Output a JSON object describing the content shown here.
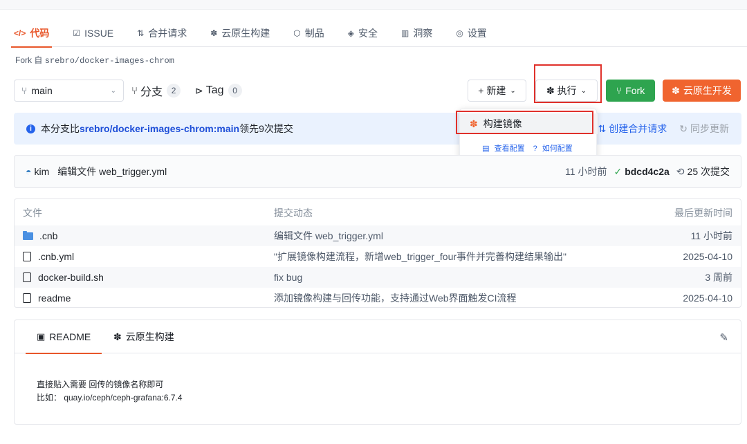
{
  "tabs": [
    {
      "icon": "</>",
      "label": "代码",
      "active": true
    },
    {
      "icon": "☑",
      "label": "ISSUE"
    },
    {
      "icon": "⇅",
      "label": "合并请求"
    },
    {
      "icon": "✽",
      "label": "云原生构建"
    },
    {
      "icon": "⬡",
      "label": "制品"
    },
    {
      "icon": "◈",
      "label": "安全"
    },
    {
      "icon": "▥",
      "label": "洞察"
    },
    {
      "icon": "◎",
      "label": "设置"
    }
  ],
  "fork": {
    "prefix": "Fork 自",
    "repo": "srebro/docker-images-chrom"
  },
  "branch": {
    "icon": "⑂",
    "name": "main"
  },
  "stats": {
    "branches_label": "分支",
    "branches_count": "2",
    "tags_label": "Tag",
    "tags_count": "0"
  },
  "buttons": {
    "new": "+ 新建",
    "run": "执行",
    "fork": "Fork",
    "cloud_dev": "云原生开发"
  },
  "dropdown": {
    "item": "构建镜像",
    "view_config": "查看配置",
    "how_config": "如何配置"
  },
  "info": {
    "prefix": "本分支比",
    "repo": "srebro/docker-images-chrom:main",
    "suffix": "领先9次提交",
    "create_mr": "创建合并请求",
    "sync": "同步更新"
  },
  "commit": {
    "author": "kim",
    "message": "编辑文件 web_trigger.yml",
    "time": "11 小时前",
    "hash": "bdcd4c2a",
    "commits": "25 次提交"
  },
  "files": {
    "headers": {
      "name": "文件",
      "activity": "提交动态",
      "updated": "最后更新时间"
    },
    "rows": [
      {
        "type": "folder",
        "name": ".cnb",
        "message": "编辑文件 web_trigger.yml",
        "time": "11 小时前"
      },
      {
        "type": "file",
        "name": ".cnb.yml",
        "message": "\"扩展镜像构建流程，新增web_trigger_four事件并完善构建结果输出\"",
        "time": "2025-04-10"
      },
      {
        "type": "file",
        "name": "docker-build.sh",
        "message": "fix bug",
        "time": "3 周前"
      },
      {
        "type": "file",
        "name": "readme",
        "message": "添加镜像构建与回传功能，支持通过Web界面触发CI流程",
        "time": "2025-04-10"
      }
    ]
  },
  "readme": {
    "tab_readme": "README",
    "tab_cloud": "云原生构建",
    "line1": "直接贴入需要 回传的镜像名称即可",
    "line2": "比如： quay.io/ceph/ceph-grafana:6.7.4"
  },
  "colors": {
    "accent": "#e8562a",
    "green": "#2ea44f",
    "orange": "#f0642f",
    "highlight": "#e0312b",
    "link": "#2563eb"
  }
}
